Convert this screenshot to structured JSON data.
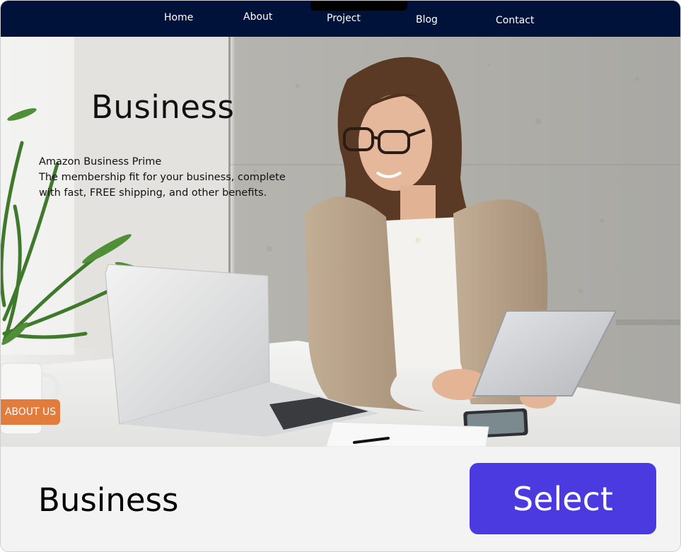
{
  "nav": {
    "items": [
      {
        "label": "Home"
      },
      {
        "label": "About"
      },
      {
        "label": "Project"
      },
      {
        "label": "Blog"
      },
      {
        "label": "Contact"
      }
    ]
  },
  "hero": {
    "title": "Business",
    "lines": [
      "Amazon Business Prime",
      "The membership fit for your business, complete",
      "with fast, FREE shipping, and other benefits."
    ],
    "cta_label": "ABOUT US",
    "image_icon": "office-woman-laptop-photo"
  },
  "footer": {
    "template_name": "Business",
    "select_label": "Select"
  },
  "colors": {
    "nav_bg": "#00113a",
    "cta_orange": "#e17c3c",
    "select_purple": "#4a3ae0",
    "footer_bg": "#f3f3f3"
  }
}
